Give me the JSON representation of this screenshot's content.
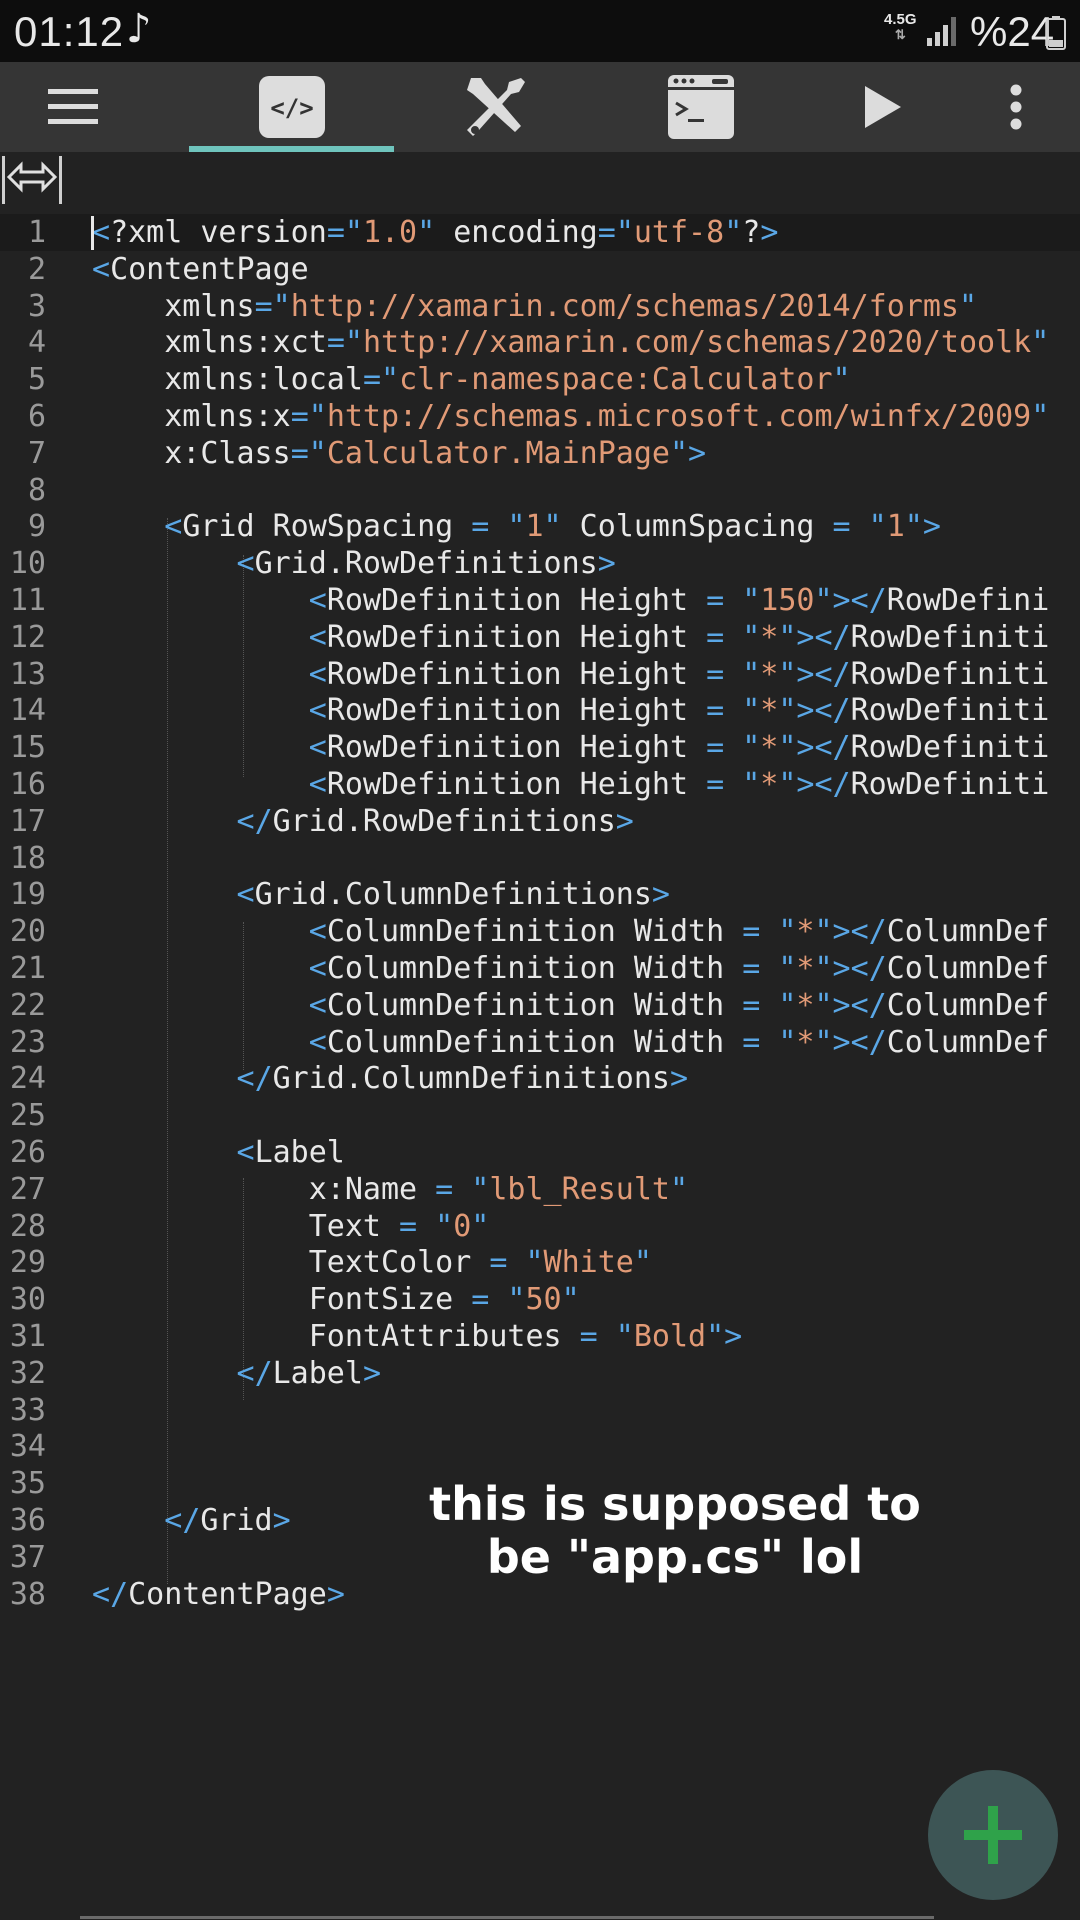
{
  "status_bar": {
    "time": "01:12",
    "music_note": "♪",
    "network": "4.5G",
    "network_arrows": "⇅",
    "battery_text": "%24"
  },
  "toolbar": {
    "icons": [
      "menu-icon",
      "code-editor-icon",
      "tools-icon",
      "terminal-icon",
      "run-icon",
      "more-icon"
    ],
    "active_tab": "code-editor",
    "accent_color": "#6fc4bd"
  },
  "editor": {
    "resize_symbol": "⇔",
    "colors": {
      "punct": "#5aa7e6",
      "text": "#e8e8e8",
      "string": "#e19a76",
      "line_number": "#9a9a9a"
    },
    "lines": [
      {
        "n": "1",
        "code": "<?xml version=\"1.0\" encoding=\"utf-8\"?>"
      },
      {
        "n": "2",
        "code": "<ContentPage"
      },
      {
        "n": "3",
        "code": "    xmlns=\"http://xamarin.com/schemas/2014/forms\""
      },
      {
        "n": "4",
        "code": "    xmlns:xct=\"http://xamarin.com/schemas/2020/toolki"
      },
      {
        "n": "5",
        "code": "    xmlns:local=\"clr-namespace:Calculator\""
      },
      {
        "n": "6",
        "code": "    xmlns:x=\"http://schemas.microsoft.com/winfx/2009/"
      },
      {
        "n": "7",
        "code": "    x:Class=\"Calculator.MainPage\">"
      },
      {
        "n": "8",
        "code": ""
      },
      {
        "n": "9",
        "code": "    <Grid RowSpacing = \"1\" ColumnSpacing = \"1\">"
      },
      {
        "n": "10",
        "code": "        <Grid.RowDefinitions>"
      },
      {
        "n": "11",
        "code": "            <RowDefinition Height = \"150\"></RowDefini"
      },
      {
        "n": "12",
        "code": "            <RowDefinition Height = \"*\"></RowDefiniti"
      },
      {
        "n": "13",
        "code": "            <RowDefinition Height = \"*\"></RowDefiniti"
      },
      {
        "n": "14",
        "code": "            <RowDefinition Height = \"*\"></RowDefiniti"
      },
      {
        "n": "15",
        "code": "            <RowDefinition Height = \"*\"></RowDefiniti"
      },
      {
        "n": "16",
        "code": "            <RowDefinition Height = \"*\"></RowDefiniti"
      },
      {
        "n": "17",
        "code": "        </Grid.RowDefinitions>"
      },
      {
        "n": "18",
        "code": ""
      },
      {
        "n": "19",
        "code": "        <Grid.ColumnDefinitions>"
      },
      {
        "n": "20",
        "code": "            <ColumnDefinition Width = \"*\"></ColumnDef"
      },
      {
        "n": "21",
        "code": "            <ColumnDefinition Width = \"*\"></ColumnDef"
      },
      {
        "n": "22",
        "code": "            <ColumnDefinition Width = \"*\"></ColumnDef"
      },
      {
        "n": "23",
        "code": "            <ColumnDefinition Width = \"*\"></ColumnDef"
      },
      {
        "n": "24",
        "code": "        </Grid.ColumnDefinitions>"
      },
      {
        "n": "25",
        "code": ""
      },
      {
        "n": "26",
        "code": "        <Label"
      },
      {
        "n": "27",
        "code": "            x:Name = \"lbl_Result\""
      },
      {
        "n": "28",
        "code": "            Text = \"0\""
      },
      {
        "n": "29",
        "code": "            TextColor = \"White\""
      },
      {
        "n": "30",
        "code": "            FontSize = \"50\""
      },
      {
        "n": "31",
        "code": "            FontAttributes = \"Bold\">"
      },
      {
        "n": "32",
        "code": "        </Label>"
      },
      {
        "n": "33",
        "code": ""
      },
      {
        "n": "34",
        "code": ""
      },
      {
        "n": "35",
        "code": ""
      },
      {
        "n": "36",
        "code": "    </Grid>"
      },
      {
        "n": "37",
        "code": ""
      },
      {
        "n": "38",
        "code": "</ContentPage>"
      }
    ]
  },
  "overlay_caption": {
    "line1": "this is supposed to",
    "line2": "be \"app.cs\" lol"
  },
  "fab": {
    "icon": "plus-icon",
    "color": "#2fa24a"
  }
}
